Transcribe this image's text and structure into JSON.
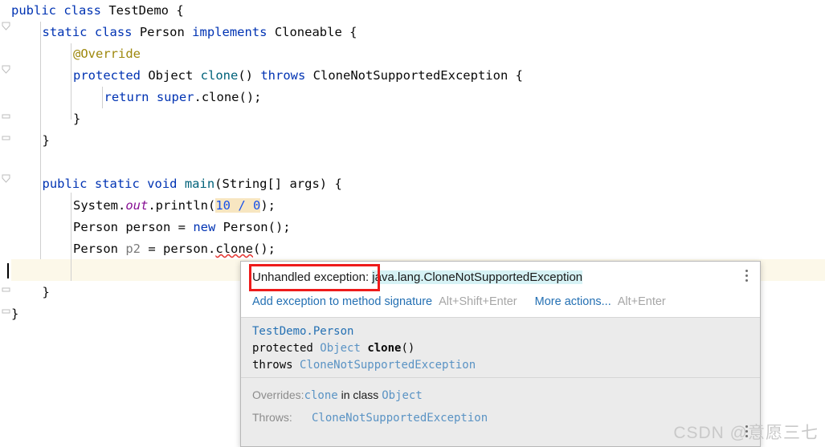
{
  "editor": {
    "language": "java",
    "lines": [
      {
        "indent": 0,
        "tokens": [
          {
            "t": "public ",
            "c": "kw"
          },
          {
            "t": "class ",
            "c": "kw"
          },
          {
            "t": "TestDemo",
            "c": "cls"
          },
          {
            "t": " {",
            "c": "plain"
          }
        ]
      },
      {
        "indent": 1,
        "tokens": [
          {
            "t": "static ",
            "c": "kw"
          },
          {
            "t": "class ",
            "c": "kw"
          },
          {
            "t": "Person ",
            "c": "cls"
          },
          {
            "t": "implements ",
            "c": "kw"
          },
          {
            "t": "Cloneable",
            "c": "cls"
          },
          {
            "t": " {",
            "c": "plain"
          }
        ]
      },
      {
        "indent": 2,
        "tokens": [
          {
            "t": "@Override",
            "c": "anno"
          }
        ]
      },
      {
        "indent": 2,
        "tokens": [
          {
            "t": "protected ",
            "c": "kw"
          },
          {
            "t": "Object ",
            "c": "cls"
          },
          {
            "t": "clone",
            "c": "meth"
          },
          {
            "t": "() ",
            "c": "plain"
          },
          {
            "t": "throws ",
            "c": "kw"
          },
          {
            "t": "CloneNotSupportedException",
            "c": "cls"
          },
          {
            "t": " {",
            "c": "plain"
          }
        ]
      },
      {
        "indent": 3,
        "tokens": [
          {
            "t": "return ",
            "c": "kw"
          },
          {
            "t": "super",
            "c": "kw"
          },
          {
            "t": ".clone();",
            "c": "plain"
          }
        ]
      },
      {
        "indent": 2,
        "tokens": [
          {
            "t": "}",
            "c": "plain"
          }
        ]
      },
      {
        "indent": 1,
        "tokens": [
          {
            "t": "}",
            "c": "plain"
          }
        ]
      },
      {
        "indent": 0,
        "tokens": []
      },
      {
        "indent": 1,
        "tokens": [
          {
            "t": "public ",
            "c": "kw"
          },
          {
            "t": "static ",
            "c": "kw"
          },
          {
            "t": "void ",
            "c": "kw"
          },
          {
            "t": "main",
            "c": "meth"
          },
          {
            "t": "(String[] args) {",
            "c": "plain"
          }
        ]
      },
      {
        "indent": 2,
        "tokens": [
          {
            "t": "System.",
            "c": "plain"
          },
          {
            "t": "out",
            "c": "fld"
          },
          {
            "t": ".println(",
            "c": "plain"
          },
          {
            "t": "10 / 0",
            "c": "hl-num"
          },
          {
            "t": ");",
            "c": "plain"
          }
        ]
      },
      {
        "indent": 2,
        "tokens": [
          {
            "t": "Person person = ",
            "c": "plain"
          },
          {
            "t": "new ",
            "c": "kw"
          },
          {
            "t": "Person();",
            "c": "plain"
          }
        ]
      },
      {
        "indent": 2,
        "tokens": [
          {
            "t": "Person ",
            "c": "plain"
          },
          {
            "t": "p2",
            "c": "pvar"
          },
          {
            "t": " = person.",
            "c": "plain"
          },
          {
            "t": "clone",
            "c": "err"
          },
          {
            "t": "();",
            "c": "plain"
          }
        ]
      },
      {
        "indent": 0,
        "tokens": []
      },
      {
        "indent": 1,
        "tokens": [
          {
            "t": "}",
            "c": "plain"
          }
        ]
      },
      {
        "indent": 0,
        "tokens": [
          {
            "t": "}",
            "c": "plain"
          }
        ]
      }
    ],
    "caret_line_index": 12,
    "highlight_color": "#f7e6c1",
    "caret_row_color": "#fcf8e9"
  },
  "popup": {
    "header": {
      "exception_prefix": "Unhandled exception: ",
      "exception_type": "java.lang.CloneNotSupportedException",
      "red_annotation_box": true
    },
    "actions": [
      {
        "label": "Add exception to method signature",
        "shortcut": "Alt+Shift+Enter"
      },
      {
        "label": "More actions...",
        "shortcut": "Alt+Enter"
      }
    ],
    "menu_icon": "kebab-menu-icon",
    "documentation": {
      "owner": "TestDemo.Person",
      "signature_line1_modifier": "protected ",
      "signature_line1_type": "Object ",
      "signature_line1_name": "clone",
      "signature_line1_params": "()",
      "signature_line2_keyword": "throws ",
      "signature_line2_type": "CloneNotSupportedException",
      "details": [
        {
          "label": "Overrides:",
          "value_mono": "clone",
          "value_plain": " in class ",
          "value_mono2": "Object"
        },
        {
          "label": "Throws:",
          "value_mono": "CloneNotSupportedException",
          "value_plain": "",
          "value_mono2": ""
        }
      ]
    }
  },
  "watermark": {
    "text": "CSDN @意愿三七"
  },
  "colors": {
    "keyword": "#0033b3",
    "annotation": "#9e880d",
    "method": "#00627a",
    "static_field": "#871094",
    "number": "#1750eb",
    "link": "#2470b3",
    "shortcut": "#a6a6a6",
    "doc_bg": "#ebebeb",
    "error_red": "#ee1b1b"
  }
}
